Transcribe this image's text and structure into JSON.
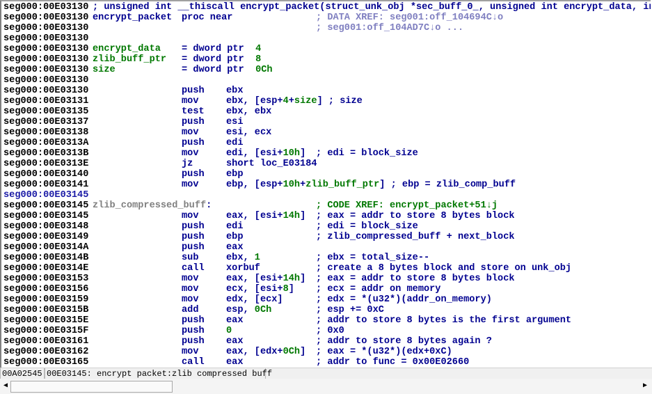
{
  "colors": {
    "keyword": "#000090",
    "name": "#007800",
    "xref": "#7f7fc0",
    "label_gray": "#808080",
    "background": "#ffffff"
  },
  "lines": [
    {
      "addr": "seg000:00E03130",
      "c0": [
        [
          "; unsigned int __thiscall encrypt_packet(struct_unk_obj *sec_buff_0_, unsigned int encrypt_data, int",
          "n"
        ]
      ]
    },
    {
      "addr": "seg000:00E03130",
      "c0": [
        [
          "encrypt_packet",
          "n"
        ]
      ],
      "c1": [
        [
          "proc near",
          "n"
        ]
      ],
      "c3": [
        [
          "; DATA XREF: seg001:off_104694C↓o",
          "x"
        ]
      ]
    },
    {
      "addr": "seg000:00E03130",
      "c3": [
        [
          "; seg001:off_104AD7C↓o ...",
          "x"
        ]
      ]
    },
    {
      "addr": "seg000:00E03130"
    },
    {
      "addr": "seg000:00E03130",
      "c0": [
        [
          "encrypt_data",
          "g"
        ]
      ],
      "c1": [
        [
          "= dword ptr  ",
          "n"
        ],
        [
          "4",
          "g"
        ]
      ]
    },
    {
      "addr": "seg000:00E03130",
      "c0": [
        [
          "zlib_buff_ptr",
          "g"
        ]
      ],
      "c1": [
        [
          "= dword ptr  ",
          "n"
        ],
        [
          "8",
          "g"
        ]
      ]
    },
    {
      "addr": "seg000:00E03130",
      "c0": [
        [
          "size",
          "g"
        ]
      ],
      "c1": [
        [
          "= dword ptr  ",
          "n"
        ],
        [
          "0Ch",
          "g"
        ]
      ]
    },
    {
      "addr": "seg000:00E03130"
    },
    {
      "addr": "seg000:00E03130",
      "c1": [
        [
          "push",
          "n"
        ]
      ],
      "c2": [
        [
          "ebx",
          "n"
        ]
      ]
    },
    {
      "addr": "seg000:00E03131",
      "c1": [
        [
          "mov",
          "n"
        ]
      ],
      "c2": [
        [
          "ebx, [esp+",
          "n"
        ],
        [
          "4",
          "g"
        ],
        [
          "+",
          "n"
        ],
        [
          "size",
          "g"
        ],
        [
          "] ; size",
          "n"
        ]
      ]
    },
    {
      "addr": "seg000:00E03135",
      "c1": [
        [
          "test",
          "n"
        ]
      ],
      "c2": [
        [
          "ebx, ebx",
          "n"
        ]
      ]
    },
    {
      "addr": "seg000:00E03137",
      "c1": [
        [
          "push",
          "n"
        ]
      ],
      "c2": [
        [
          "esi",
          "n"
        ]
      ]
    },
    {
      "addr": "seg000:00E03138",
      "c1": [
        [
          "mov",
          "n"
        ]
      ],
      "c2": [
        [
          "esi, ecx",
          "n"
        ]
      ]
    },
    {
      "addr": "seg000:00E0313A",
      "c1": [
        [
          "push",
          "n"
        ]
      ],
      "c2": [
        [
          "edi",
          "n"
        ]
      ]
    },
    {
      "addr": "seg000:00E0313B",
      "c1": [
        [
          "mov",
          "n"
        ]
      ],
      "c2": [
        [
          "edi, [esi+",
          "n"
        ],
        [
          "10h",
          "g"
        ],
        [
          "]",
          "n"
        ]
      ],
      "c3": [
        [
          "; edi = block_size",
          "n"
        ]
      ]
    },
    {
      "addr": "seg000:00E0313E",
      "c1": [
        [
          "jz",
          "n"
        ]
      ],
      "c2": [
        [
          "short loc_E03184",
          "n"
        ]
      ]
    },
    {
      "addr": "seg000:00E03140",
      "c1": [
        [
          "push",
          "n"
        ]
      ],
      "c2": [
        [
          "ebp",
          "n"
        ]
      ]
    },
    {
      "addr": "seg000:00E03141",
      "c1": [
        [
          "mov",
          "n"
        ]
      ],
      "c2": [
        [
          "ebp, [esp+",
          "n"
        ],
        [
          "10h",
          "g"
        ],
        [
          "+",
          "n"
        ],
        [
          "zlib_buff_ptr",
          "g"
        ],
        [
          "] ; ebp = zlib_comp_buff",
          "n"
        ]
      ]
    },
    {
      "addr": "seg000:00E03145",
      "addr_style": "b"
    },
    {
      "addr": "seg000:00E03145",
      "c0": [
        [
          "zlib_compressed_buff",
          "gr"
        ],
        [
          ":",
          "n"
        ]
      ],
      "c3": [
        [
          "; CODE XREF: encrypt_packet+51↓j",
          "cx"
        ]
      ]
    },
    {
      "addr": "seg000:00E03145",
      "c1": [
        [
          "mov",
          "n"
        ]
      ],
      "c2": [
        [
          "eax, [esi+",
          "n"
        ],
        [
          "14h",
          "g"
        ],
        [
          "]",
          "n"
        ]
      ],
      "c3": [
        [
          "; eax = addr to store 8 bytes block",
          "n"
        ]
      ]
    },
    {
      "addr": "seg000:00E03148",
      "c1": [
        [
          "push",
          "n"
        ]
      ],
      "c2": [
        [
          "edi",
          "n"
        ]
      ],
      "c3": [
        [
          "; edi = block_size",
          "n"
        ]
      ]
    },
    {
      "addr": "seg000:00E03149",
      "c1": [
        [
          "push",
          "n"
        ]
      ],
      "c2": [
        [
          "ebp",
          "n"
        ]
      ],
      "c3": [
        [
          "; zlib_compressed_buff + next_block",
          "n"
        ]
      ]
    },
    {
      "addr": "seg000:00E0314A",
      "c1": [
        [
          "push",
          "n"
        ]
      ],
      "c2": [
        [
          "eax",
          "n"
        ]
      ]
    },
    {
      "addr": "seg000:00E0314B",
      "c1": [
        [
          "sub",
          "n"
        ]
      ],
      "c2": [
        [
          "ebx, ",
          "n"
        ],
        [
          "1",
          "g"
        ]
      ],
      "c3": [
        [
          "; ebx = total_size--",
          "n"
        ]
      ]
    },
    {
      "addr": "seg000:00E0314E",
      "c1": [
        [
          "call",
          "n"
        ]
      ],
      "c2": [
        [
          "xorbuf",
          "n"
        ]
      ],
      "c3": [
        [
          "; create a 8 bytes block and store on unk_obj",
          "n"
        ]
      ]
    },
    {
      "addr": "seg000:00E03153",
      "c1": [
        [
          "mov",
          "n"
        ]
      ],
      "c2": [
        [
          "eax, [esi+",
          "n"
        ],
        [
          "14h",
          "g"
        ],
        [
          "]",
          "n"
        ]
      ],
      "c3": [
        [
          "; eax = addr to store 8 bytes block",
          "n"
        ]
      ]
    },
    {
      "addr": "seg000:00E03156",
      "c1": [
        [
          "mov",
          "n"
        ]
      ],
      "c2": [
        [
          "ecx, [esi+",
          "n"
        ],
        [
          "8",
          "g"
        ],
        [
          "]",
          "n"
        ]
      ],
      "c3": [
        [
          "; ecx = addr on memory",
          "n"
        ]
      ]
    },
    {
      "addr": "seg000:00E03159",
      "c1": [
        [
          "mov",
          "n"
        ]
      ],
      "c2": [
        [
          "edx, [ecx]",
          "n"
        ]
      ],
      "c3": [
        [
          "; edx = *(u32*)(addr_on_memory)",
          "n"
        ]
      ]
    },
    {
      "addr": "seg000:00E0315B",
      "c1": [
        [
          "add",
          "n"
        ]
      ],
      "c2": [
        [
          "esp, ",
          "n"
        ],
        [
          "0Ch",
          "g"
        ]
      ],
      "c3": [
        [
          "; esp += 0xC",
          "n"
        ]
      ]
    },
    {
      "addr": "seg000:00E0315E",
      "c1": [
        [
          "push",
          "n"
        ]
      ],
      "c2": [
        [
          "eax",
          "n"
        ]
      ],
      "c3": [
        [
          "; addr to store 8 bytes is the first argument",
          "n"
        ]
      ]
    },
    {
      "addr": "seg000:00E0315F",
      "c1": [
        [
          "push",
          "n"
        ]
      ],
      "c2": [
        [
          "0",
          "g"
        ]
      ],
      "c3": [
        [
          "; 0x0",
          "n"
        ]
      ]
    },
    {
      "addr": "seg000:00E03161",
      "c1": [
        [
          "push",
          "n"
        ]
      ],
      "c2": [
        [
          "eax",
          "n"
        ]
      ],
      "c3": [
        [
          "; addr to store 8 bytes again ?",
          "n"
        ]
      ]
    },
    {
      "addr": "seg000:00E03162",
      "c1": [
        [
          "mov",
          "n"
        ]
      ],
      "c2": [
        [
          "eax, [edx+",
          "n"
        ],
        [
          "0Ch",
          "g"
        ],
        [
          "]",
          "n"
        ]
      ],
      "c3": [
        [
          "; eax = *(u32*)(edx+0xC)",
          "n"
        ]
      ]
    },
    {
      "addr": "seg000:00E03165",
      "c1": [
        [
          "call",
          "n"
        ]
      ],
      "c2": [
        [
          "eax",
          "n"
        ]
      ],
      "c3": [
        [
          "; addr to func = 0x00E02660",
          "n"
        ]
      ]
    }
  ],
  "status": {
    "offset": "00A02545",
    "location": "00E03145: encrypt packet:zlib compressed buff"
  },
  "scrollbar": {
    "left_icon": "arrow-left-icon",
    "right_icon": "arrow-right-icon",
    "left_glyph": "◀",
    "right_glyph": "▶"
  }
}
